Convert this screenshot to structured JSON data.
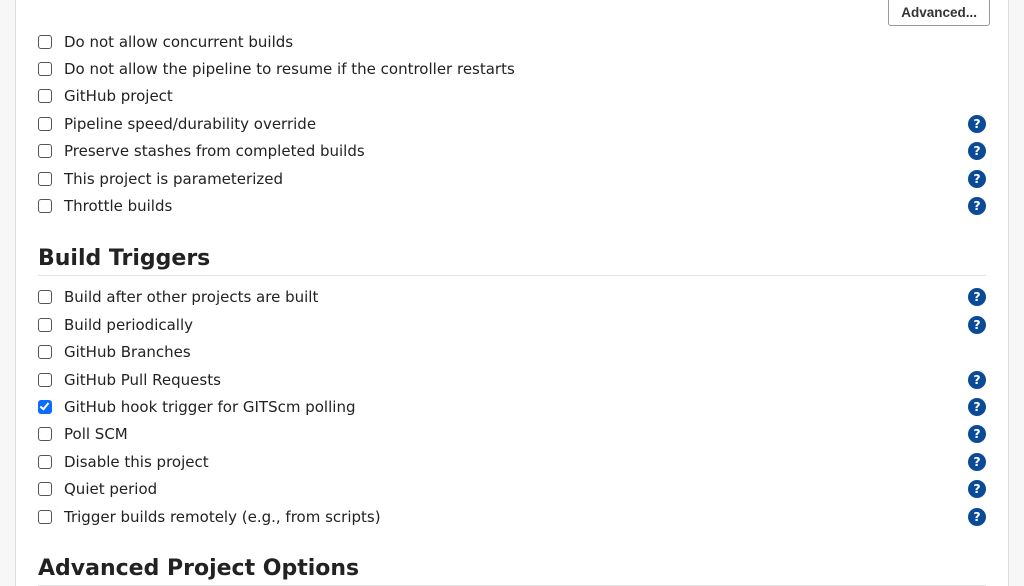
{
  "buttons": {
    "advanced": "Advanced..."
  },
  "general": {
    "options": [
      {
        "label": "Do not allow concurrent builds",
        "checked": false,
        "help": false
      },
      {
        "label": "Do not allow the pipeline to resume if the controller restarts",
        "checked": false,
        "help": false
      },
      {
        "label": "GitHub project",
        "checked": false,
        "help": false
      },
      {
        "label": "Pipeline speed/durability override",
        "checked": false,
        "help": true
      },
      {
        "label": "Preserve stashes from completed builds",
        "checked": false,
        "help": true
      },
      {
        "label": "This project is parameterized",
        "checked": false,
        "help": true
      },
      {
        "label": "Throttle builds",
        "checked": false,
        "help": true
      }
    ]
  },
  "sections": {
    "build_triggers": "Build Triggers",
    "advanced_project_options": "Advanced Project Options"
  },
  "build_triggers": {
    "options": [
      {
        "label": "Build after other projects are built",
        "checked": false,
        "help": true
      },
      {
        "label": "Build periodically",
        "checked": false,
        "help": true
      },
      {
        "label": "GitHub Branches",
        "checked": false,
        "help": false
      },
      {
        "label": "GitHub Pull Requests",
        "checked": false,
        "help": true
      },
      {
        "label": "GitHub hook trigger for GITScm polling",
        "checked": true,
        "help": true
      },
      {
        "label": "Poll SCM",
        "checked": false,
        "help": true
      },
      {
        "label": "Disable this project",
        "checked": false,
        "help": true
      },
      {
        "label": "Quiet period",
        "checked": false,
        "help": true
      },
      {
        "label": "Trigger builds remotely (e.g., from scripts)",
        "checked": false,
        "help": true
      }
    ]
  }
}
